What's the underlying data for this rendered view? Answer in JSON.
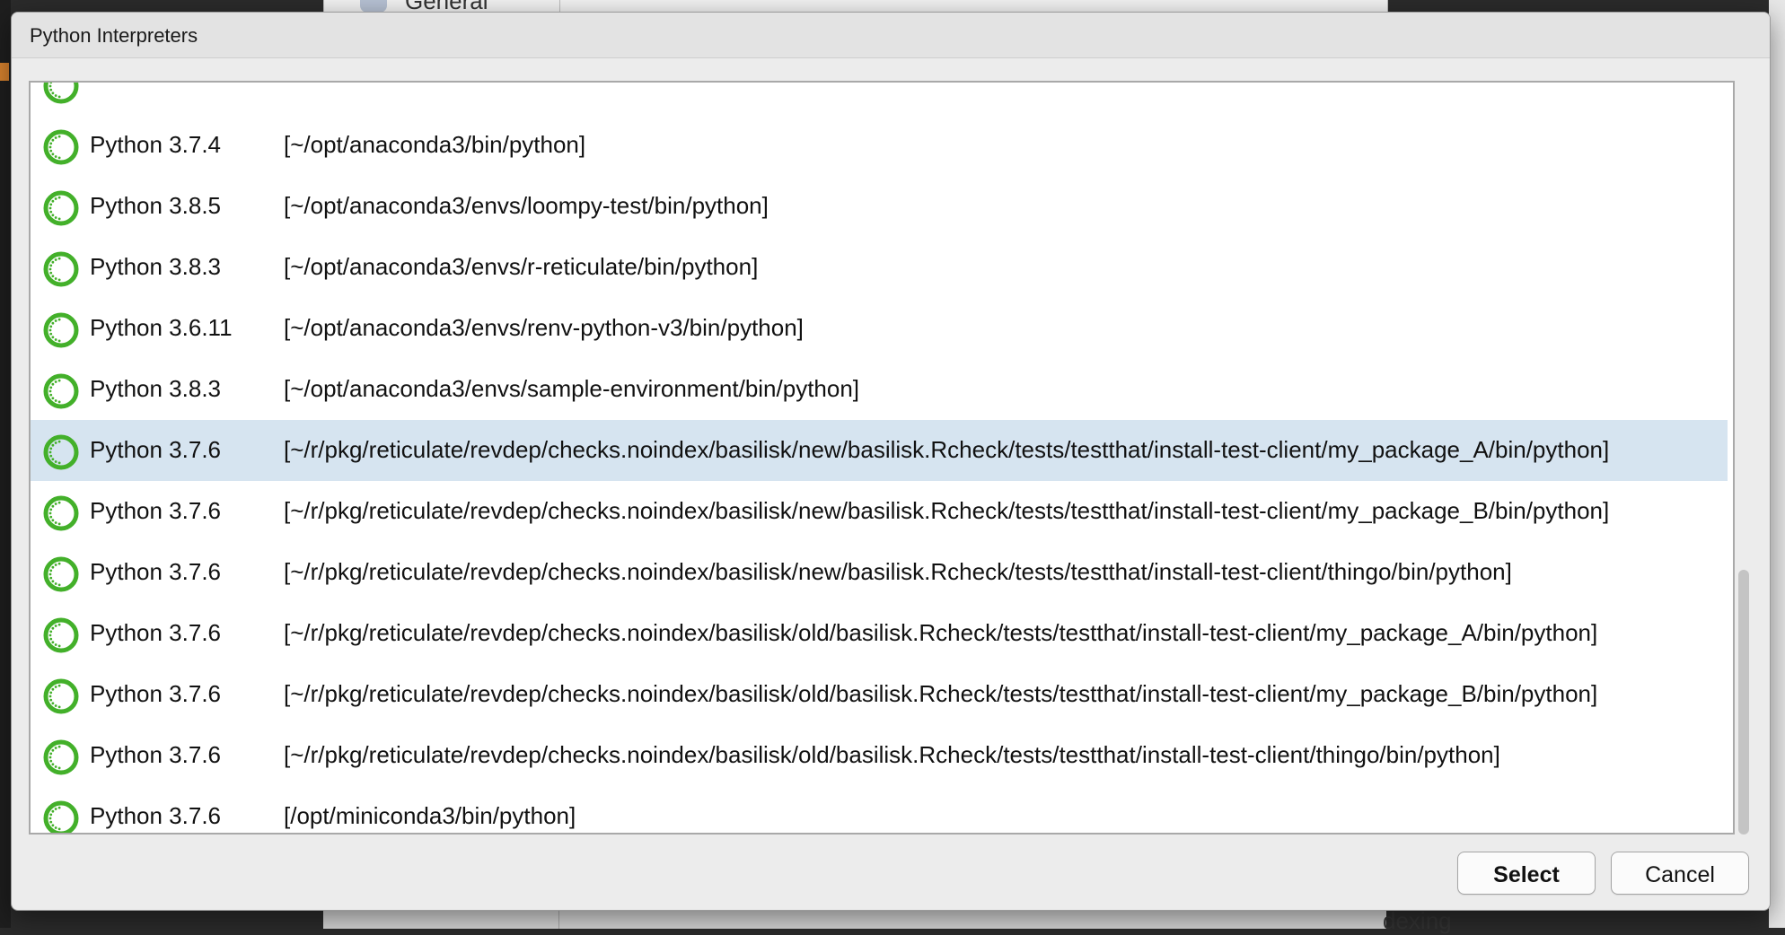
{
  "dialog": {
    "title": "Python Interpreters"
  },
  "background": {
    "top_label": "General",
    "bottom_label": "dexing"
  },
  "interpreters": [
    {
      "version": "",
      "path": "",
      "selected": false
    },
    {
      "version": "Python 3.7.4",
      "path": "[~/opt/anaconda3/bin/python]",
      "selected": false
    },
    {
      "version": "Python 3.8.5",
      "path": "[~/opt/anaconda3/envs/loompy-test/bin/python]",
      "selected": false
    },
    {
      "version": "Python 3.8.3",
      "path": "[~/opt/anaconda3/envs/r-reticulate/bin/python]",
      "selected": false
    },
    {
      "version": "Python 3.6.11",
      "path": "[~/opt/anaconda3/envs/renv-python-v3/bin/python]",
      "selected": false
    },
    {
      "version": "Python 3.8.3",
      "path": "[~/opt/anaconda3/envs/sample-environment/bin/python]",
      "selected": false
    },
    {
      "version": "Python 3.7.6",
      "path": "[~/r/pkg/reticulate/revdep/checks.noindex/basilisk/new/basilisk.Rcheck/tests/testthat/install-test-client/my_package_A/bin/python]",
      "selected": true
    },
    {
      "version": "Python 3.7.6",
      "path": "[~/r/pkg/reticulate/revdep/checks.noindex/basilisk/new/basilisk.Rcheck/tests/testthat/install-test-client/my_package_B/bin/python]",
      "selected": false
    },
    {
      "version": "Python 3.7.6",
      "path": "[~/r/pkg/reticulate/revdep/checks.noindex/basilisk/new/basilisk.Rcheck/tests/testthat/install-test-client/thingo/bin/python]",
      "selected": false
    },
    {
      "version": "Python 3.7.6",
      "path": "[~/r/pkg/reticulate/revdep/checks.noindex/basilisk/old/basilisk.Rcheck/tests/testthat/install-test-client/my_package_A/bin/python]",
      "selected": false
    },
    {
      "version": "Python 3.7.6",
      "path": "[~/r/pkg/reticulate/revdep/checks.noindex/basilisk/old/basilisk.Rcheck/tests/testthat/install-test-client/my_package_B/bin/python]",
      "selected": false
    },
    {
      "version": "Python 3.7.6",
      "path": "[~/r/pkg/reticulate/revdep/checks.noindex/basilisk/old/basilisk.Rcheck/tests/testthat/install-test-client/thingo/bin/python]",
      "selected": false
    },
    {
      "version": "Python 3.7.6",
      "path": "[/opt/miniconda3/bin/python]",
      "selected": false
    }
  ],
  "icon": {
    "name": "conda-ring-icon",
    "color": "#43b02a",
    "inner_color": "#ffffff"
  },
  "colors": {
    "selected_row": "#d6e4f0"
  },
  "buttons": {
    "select_label": "Select",
    "cancel_label": "Cancel"
  }
}
